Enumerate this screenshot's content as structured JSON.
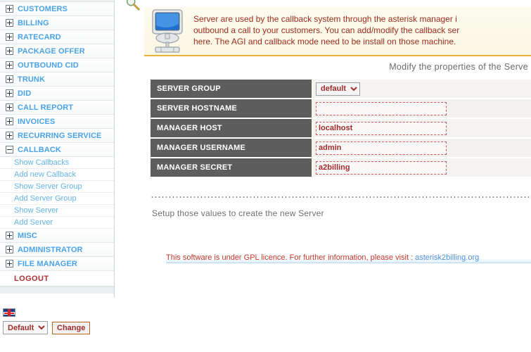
{
  "sidebar": {
    "items": [
      {
        "label": "CUSTOMERS",
        "state": "collapsed"
      },
      {
        "label": "BILLING",
        "state": "collapsed"
      },
      {
        "label": "RATECARD",
        "state": "collapsed"
      },
      {
        "label": "PACKAGE OFFER",
        "state": "collapsed"
      },
      {
        "label": "OUTBOUND CID",
        "state": "collapsed"
      },
      {
        "label": "TRUNK",
        "state": "collapsed"
      },
      {
        "label": "DID",
        "state": "collapsed"
      },
      {
        "label": "CALL REPORT",
        "state": "collapsed"
      },
      {
        "label": "INVOICES",
        "state": "collapsed"
      },
      {
        "label": "RECURRING SERVICE",
        "state": "collapsed"
      },
      {
        "label": "CALLBACK",
        "state": "expanded"
      }
    ],
    "callback_subitems": [
      {
        "label": "Show Callbacks"
      },
      {
        "label": "Add new Callback"
      },
      {
        "label": "Show Server Group"
      },
      {
        "label": "Add Server Group"
      },
      {
        "label": "Show Server"
      },
      {
        "label": "Add Server"
      }
    ],
    "items_after": [
      {
        "label": "MISC",
        "state": "collapsed"
      },
      {
        "label": "ADMINISTRATOR",
        "state": "collapsed"
      },
      {
        "label": "FILE MANAGER",
        "state": "collapsed"
      }
    ],
    "logout_label": "LOGOUT"
  },
  "language": {
    "flag_icon": "uk-flag-icon",
    "selected": "Default",
    "options": [
      "Default"
    ],
    "change_label": "Change"
  },
  "banner": {
    "icon": "server-monitor-icon",
    "line1": "Server are used by the callback system through the asterisk manager i",
    "line2": "outbound a call to your customers. You can add/modify the callback ser",
    "line3": "here. The AGI and callback mode need to be install on those machine."
  },
  "main": {
    "search_icon": "magnifier-icon",
    "subtitle": "Modify the properties of the Serve",
    "setup_note": "Setup those values to create the new Server"
  },
  "form": {
    "rows": [
      {
        "label": "SERVER GROUP",
        "type": "select",
        "value": "default",
        "options": [
          "default"
        ],
        "placeholder": ""
      },
      {
        "label": "SERVER HOSTNAME",
        "type": "text",
        "value": "",
        "placeholder": ""
      },
      {
        "label": "MANAGER HOST",
        "type": "text",
        "value": "localhost",
        "placeholder": ""
      },
      {
        "label": "MANAGER USERNAME",
        "type": "text",
        "value": "admin",
        "placeholder": ""
      },
      {
        "label": "MANAGER SECRET",
        "type": "text",
        "value": "a2billing",
        "placeholder": ""
      }
    ]
  },
  "footer": {
    "gpl_text": "This software is under GPL licence. For further information, please visit :",
    "gpl_link": "asterisk2billing.org"
  },
  "colors": {
    "nav_link": "#4aa3e8",
    "nav_sublink": "#63b4e8",
    "logout": "#b03030",
    "label_cell_bg": "#5d5d5d",
    "input_text": "#a02c2c",
    "banner_text": "#9c2d1e",
    "banner_border": "#e8b33a",
    "gpl_link": "#4a90d9"
  }
}
